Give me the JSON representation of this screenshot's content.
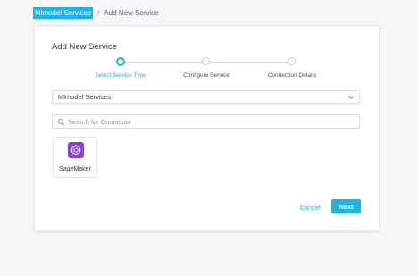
{
  "breadcrumb": {
    "parent_label": "Mlmodel Services",
    "separator": "/",
    "current_label": "Add New Service"
  },
  "card": {
    "title": "Add New Service"
  },
  "stepper": {
    "steps": [
      {
        "label": "Select Service Type",
        "state": "active"
      },
      {
        "label": "Configure Service",
        "state": "pending"
      },
      {
        "label": "Connection Details",
        "state": "pending"
      }
    ]
  },
  "service_type_select": {
    "selected_value": "Mlmodel Services",
    "icon": "chevron-down-icon"
  },
  "search": {
    "placeholder": "Search for Connector",
    "value": "",
    "icon": "search-icon"
  },
  "connectors": [
    {
      "label": "SageMaker",
      "icon": "sagemaker-logo"
    }
  ],
  "actions": {
    "cancel_label": "Cancel",
    "next_label": "Next"
  },
  "colors": {
    "accent": "#15b7ea",
    "step_pending": "#cfc6ef",
    "sagemaker_brand": "#8b3fd9"
  }
}
